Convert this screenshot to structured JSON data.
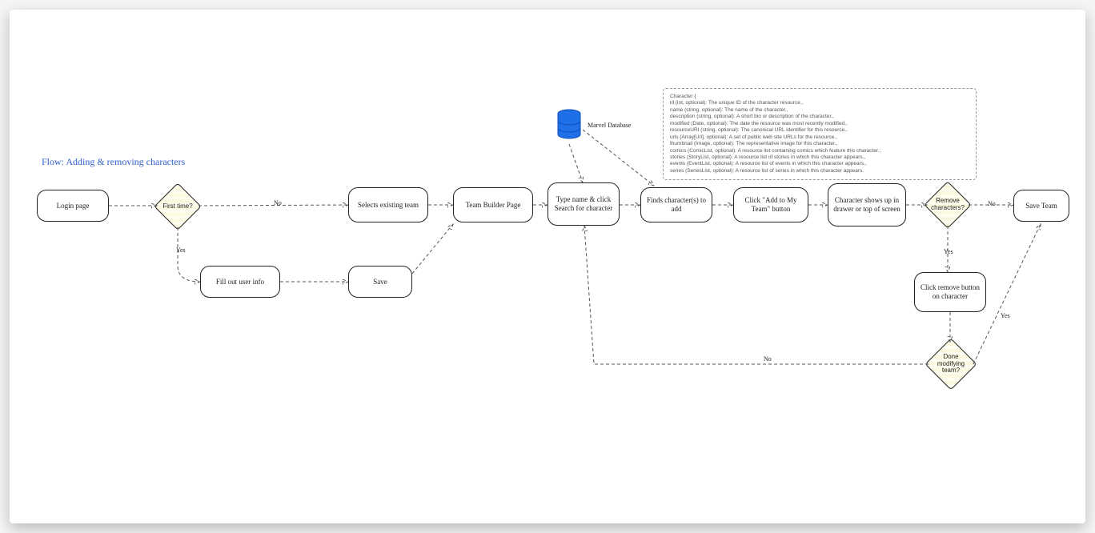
{
  "title": "Flow:  Adding & removing characters",
  "nodes": {
    "login": "Login page",
    "first_time": "First time?",
    "fill_info": "Fill out user info",
    "save_user": "Save",
    "select_team": "Selects existing team",
    "team_builder": "Team Builder Page",
    "search": "Type name & click Search for character",
    "finds": "Finds character(s) to add",
    "add_btn": "Click \"Add to My Team\" button",
    "char_shows": "Character shows up in drawer or top of screen",
    "remove_q": "Remove characters?",
    "click_remove": "Click remove button on character",
    "done_q": "Done modifying team?",
    "save_team": "Save Team"
  },
  "labels": {
    "yes1": "Yes",
    "no1": "No",
    "yes2": "Yes",
    "no2": "No",
    "yes3": "Yes",
    "no3": "No"
  },
  "db_label": "Marvel Database",
  "schema_lines": [
    "Character {",
    "id (int, optional): The unique ID of the character resource.,",
    "name (string, optional): The name of the character.,",
    "description (string, optional): A short bio or description of the character.,",
    "modified (Date, optional): The date the resource was most recently modified.,",
    "resourceURI (string, optional): The canonical URL identifier for this resource.,",
    "urls (Array[Url], optional): A set of public web site URLs for the resource.,",
    "thumbnail (Image, optional): The representative image for this character.,",
    "comics (ComicList, optional): A resource list containing comics which feature this character.,",
    "stories (StoryList, optional): A resource list of stories in which this character appears.,",
    "events (EventList, optional): A resource list of events in which this character appears.,",
    "series (SeriesList, optional): A resource list of series in which this character appears."
  ]
}
